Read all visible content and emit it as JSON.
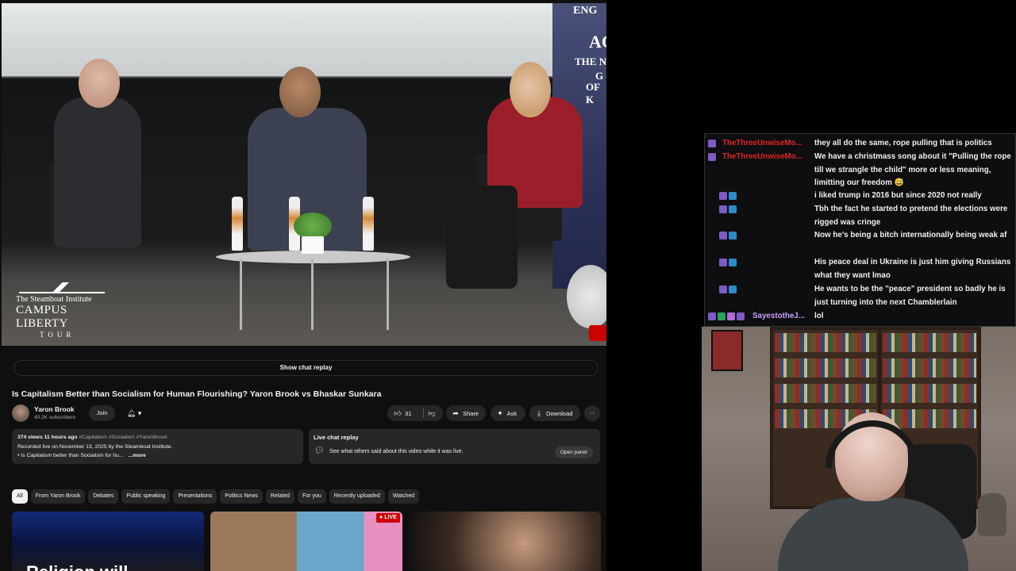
{
  "youtube": {
    "video": {
      "banner_text": [
        "ENG",
        "AC",
        "THE N",
        "G",
        "OF K"
      ],
      "logo": {
        "line1": "The Steamboat Institute",
        "line2": "CAMPUS LIBERTY",
        "line3": "TOUR"
      }
    },
    "show_chat_replay": "Show chat replay",
    "title": "Is Capitalism Better than Socialism for Human Flourishing? Yaron Brook vs Bhaskar Sunkara",
    "channel": {
      "name": "Yaron Brook",
      "subscribers": "40.2K subscribers"
    },
    "join_label": "Join",
    "actions": {
      "like_count": "31",
      "share_label": "Share",
      "ask_label": "Ask",
      "download_label": "Download"
    },
    "description": {
      "stats": "374 views  11 hours ago",
      "tags": "#Capitalism #Socialism #YaronBrook",
      "line2": "Recorded live on November 13, 2025 by the Steamboat Institute.",
      "line3": "• Is Capitalism better than Socialism for hu...",
      "more": "...more"
    },
    "live_replay": {
      "title": "Live chat replay",
      "text": "See what others said about this video while it was live.",
      "button": "Open panel"
    },
    "chips": [
      "All",
      "From Yaron Brook",
      "Debates",
      "Public speaking",
      "Presentations",
      "Politics News",
      "Related",
      "For you",
      "Recently uploaded",
      "Watched"
    ],
    "thumb1_text": "Religion will",
    "live_badge": "LIVE"
  },
  "chat": {
    "messages": [
      {
        "user": "TheThreeUnwiseMo...",
        "text": "they all do the same, rope pulling that is politics",
        "user_color": "#e02424"
      },
      {
        "user": "TheThreeUnwiseMo...",
        "text": "We have a christmass song about it \"Pulling the rope till we strangle the child\" more or less meaning, limitting our freedom 😅",
        "user_color": "#e02424"
      },
      {
        "user": "",
        "text": "i liked trump in 2016 but since 2020 not really",
        "user_color": "#ffffff"
      },
      {
        "user": "",
        "text": "Tbh the fact he started to pretend the elections were rigged was cringe",
        "user_color": "#ffffff"
      },
      {
        "user": "",
        "text": "Now he's being a bitch internationally being weak af",
        "user_color": "#ffffff"
      },
      {
        "user": "",
        "text": "His peace deal in Ukraine is just him giving Russians what they want lmao",
        "user_color": "#ffffff"
      },
      {
        "user": "",
        "text": "He wants to be the \"peace\" president so badly he is just turning into the next Chamblerlain",
        "user_color": "#ffffff"
      },
      {
        "user": "SayestotheJ...",
        "text": "lol",
        "user_color": "#c8a0ff"
      }
    ]
  }
}
